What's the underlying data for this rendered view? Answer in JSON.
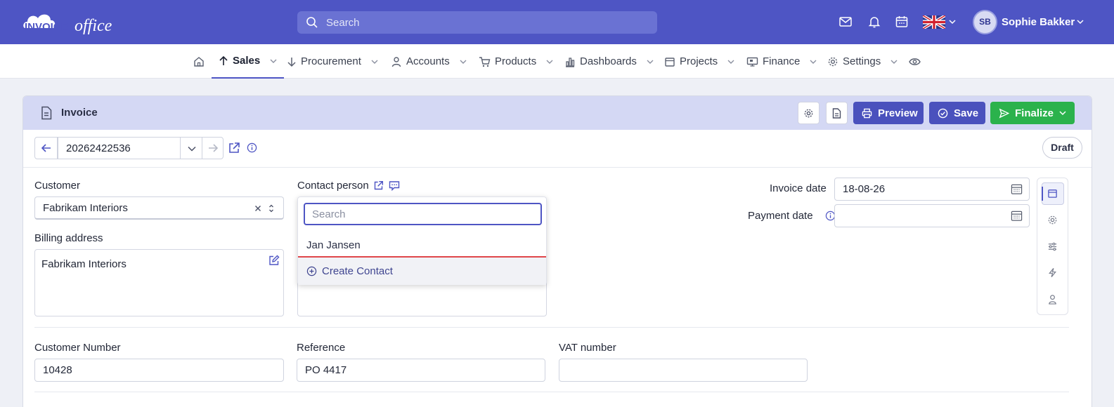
{
  "header": {
    "logo_text": "invoiceoffice",
    "search_placeholder": "Search",
    "user_initials": "SB",
    "user_name": "Sophie Bakker"
  },
  "nav": {
    "items": [
      {
        "label": "Sales",
        "active": true
      },
      {
        "label": "Procurement"
      },
      {
        "label": "Accounts"
      },
      {
        "label": "Products"
      },
      {
        "label": "Dashboards"
      },
      {
        "label": "Projects"
      },
      {
        "label": "Finance"
      },
      {
        "label": "Settings"
      }
    ]
  },
  "card": {
    "title": "Invoice",
    "preview_label": "Preview",
    "save_label": "Save",
    "finalize_label": "Finalize",
    "invoice_number": "20262422536",
    "status": "Draft"
  },
  "form": {
    "customer_label": "Customer",
    "customer_value": "Fabrikam Interiors",
    "billing_label": "Billing address",
    "billing_value": "Fabrikam Interiors",
    "contact_label": "Contact person",
    "contact_search_placeholder": "Search",
    "contact_options": [
      "Jan Jansen"
    ],
    "create_contact_label": "Create Contact",
    "invoice_date_label": "Invoice date",
    "invoice_date_value": "18-08-26",
    "payment_date_label": "Payment date",
    "payment_date_value": "",
    "customer_number_label": "Customer Number",
    "customer_number_value": "10428",
    "reference_label": "Reference",
    "reference_value": "PO 4417",
    "vat_label": "VAT number",
    "vat_value": ""
  },
  "colors": {
    "brand": "#4e55c4",
    "save": "#4a51bd",
    "finalize": "#2bb24c"
  }
}
